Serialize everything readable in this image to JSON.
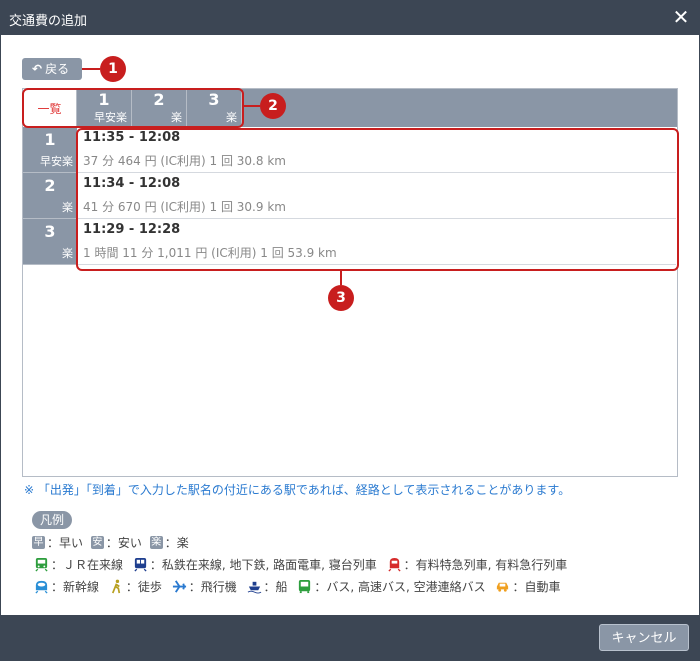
{
  "window": {
    "title": "交通費の追加",
    "close_icon": "close-icon"
  },
  "back_button": {
    "label": "戻る"
  },
  "callouts": [
    "1",
    "2",
    "3"
  ],
  "tabs": [
    {
      "label": "一覧",
      "active": true
    },
    {
      "num": "1",
      "badges": "早安楽"
    },
    {
      "num": "2",
      "badges": "楽"
    },
    {
      "num": "3",
      "badges": "楽"
    }
  ],
  "routes": [
    {
      "num": "1",
      "badges": "早安楽",
      "time": "11:35 - 12:08",
      "detail": "37 分 464 円 (IC利用) 1 回 30.8 km"
    },
    {
      "num": "2",
      "badges": "楽",
      "time": "11:34 - 12:08",
      "detail": "41 分 670 円 (IC利用) 1 回 30.9 km"
    },
    {
      "num": "3",
      "badges": "楽",
      "time": "11:29 - 12:28",
      "detail": "1 時間 11 分 1,011 円 (IC利用) 1 回 53.9 km"
    }
  ],
  "note": "※ 「出発」「到着」で入力した駅名の付近にある駅であれば、経路として表示されることがあります。",
  "legend": {
    "title": "凡例",
    "row1": [
      {
        "badge": "早",
        "text": "：早い"
      },
      {
        "badge": "安",
        "text": "：安い"
      },
      {
        "badge": "楽",
        "text": "：楽"
      }
    ],
    "row2": [
      {
        "icon": "train-icon",
        "color": "#2e9e3e",
        "text": "：ＪＲ在来線"
      },
      {
        "icon": "private-train-icon",
        "color": "#1f3f8f",
        "text": "：私鉄在来線, 地下鉄, 路面電車, 寝台列車"
      },
      {
        "icon": "express-train-icon",
        "color": "#d62b2b",
        "text": "：有料特急列車, 有料急行列車"
      }
    ],
    "row3": [
      {
        "icon": "shinkansen-icon",
        "color": "#2a8fd6",
        "text": "：新幹線"
      },
      {
        "icon": "walk-icon",
        "color": "#b8a020",
        "text": "：徒歩"
      },
      {
        "icon": "airplane-icon",
        "color": "#2a7ad0",
        "text": "：飛行機"
      },
      {
        "icon": "ship-icon",
        "color": "#1f3f8f",
        "text": "：船"
      },
      {
        "icon": "bus-icon",
        "color": "#2e9e3e",
        "text": "：バス, 高速バス, 空港連絡バス"
      },
      {
        "icon": "car-icon",
        "color": "#f0a020",
        "text": "：自動車"
      }
    ]
  },
  "footer": {
    "cancel_label": "キャンセル"
  }
}
